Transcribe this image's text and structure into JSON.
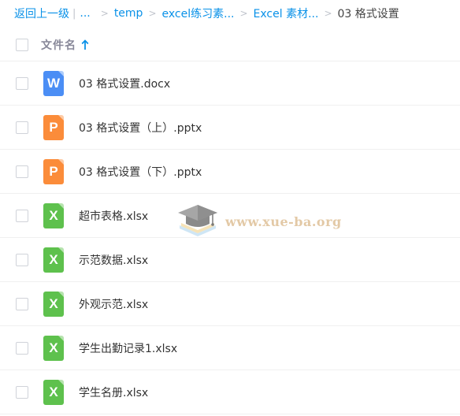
{
  "breadcrumb": {
    "back_label": "返回上一级",
    "separator": "|",
    "ellipsis": "...",
    "arrow": ">",
    "items": [
      "temp",
      "excel练习素...",
      "Excel 素材..."
    ],
    "current": "03 格式设置"
  },
  "header": {
    "column_label": "文件名",
    "sort_icon": "arrow-up-icon"
  },
  "files": [
    {
      "name": "03 格式设置.docx",
      "type": "word",
      "icon_letter": "W",
      "color": "#4b8ef5"
    },
    {
      "name": "03 格式设置（上）.pptx",
      "type": "ppt",
      "icon_letter": "P",
      "color": "#fb8c3a"
    },
    {
      "name": "03 格式设置（下）.pptx",
      "type": "ppt",
      "icon_letter": "P",
      "color": "#fb8c3a"
    },
    {
      "name": "超市表格.xlsx",
      "type": "excel",
      "icon_letter": "X",
      "color": "#5ec14d"
    },
    {
      "name": "示范数据.xlsx",
      "type": "excel",
      "icon_letter": "X",
      "color": "#5ec14d"
    },
    {
      "name": "外观示范.xlsx",
      "type": "excel",
      "icon_letter": "X",
      "color": "#5ec14d"
    },
    {
      "name": "学生出勤记录1.xlsx",
      "type": "excel",
      "icon_letter": "X",
      "color": "#5ec14d"
    },
    {
      "name": "学生名册.xlsx",
      "type": "excel",
      "icon_letter": "X",
      "color": "#5ec14d"
    }
  ],
  "watermark": {
    "text": "www.xue-ba.org",
    "icon": "graduation-cap-icon"
  },
  "colors": {
    "link": "#0991e8",
    "word": "#4b8ef5",
    "ppt": "#fb8c3a",
    "excel": "#5ec14d"
  }
}
